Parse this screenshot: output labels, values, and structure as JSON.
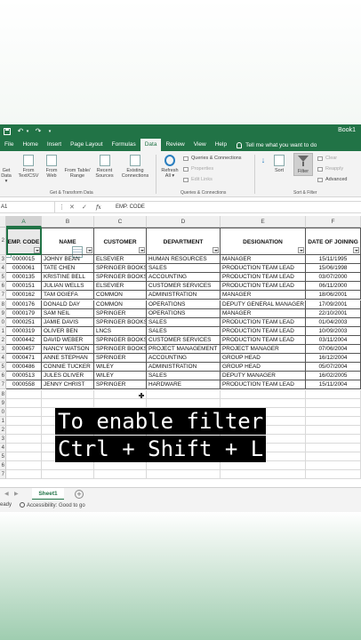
{
  "titlebar": {
    "book": "Book1"
  },
  "tabs": [
    "File",
    "Home",
    "Insert",
    "Page Layout",
    "Formulas",
    "Data",
    "Review",
    "View",
    "Help"
  ],
  "active_tab": "Data",
  "tell_me": "Tell me what you want to do",
  "ribbon": {
    "get_data": [
      "Get",
      "Data ▾"
    ],
    "from_text": [
      "From",
      "Text/CSV"
    ],
    "from_web": [
      "From",
      "Web"
    ],
    "from_table": [
      "From Table/",
      "Range"
    ],
    "recent_sources": [
      "Recent",
      "Sources"
    ],
    "existing_connections": [
      "Existing",
      "Connections"
    ],
    "group_get_transform": "Get & Transform Data",
    "refresh_all": [
      "Refresh",
      "All ▾"
    ],
    "queries_connections": "Queries & Connections",
    "properties": "Properties",
    "edit_links": "Edit Links",
    "group_queries": "Queries & Connections",
    "sort": "Sort",
    "filter": "Filter",
    "clear": "Clear",
    "reapply": "Reapply",
    "advanced": "Advanced",
    "group_sort_filter": "Sort & Filter"
  },
  "formula_bar": {
    "name_box": "A1",
    "fx": "fx",
    "content": "EMP. CODE"
  },
  "columns": [
    "A",
    "B",
    "C",
    "D",
    "E",
    "F"
  ],
  "headers": [
    "EMP. CODE",
    "NAME",
    "CUSTOMER",
    "DEPARTMENT",
    "DESIGNATION",
    "DATE OF JOINING"
  ],
  "rows": [
    [
      "0000015",
      "JOHNY BEAN",
      "ELSEVIER",
      "HUMAN RESOURCES",
      "MANAGER",
      "15/11/1995"
    ],
    [
      "0000061",
      "TATE CHEN",
      "SPRINGER BOOKS",
      "SALES",
      "PRODUCTION TEAM LEAD",
      "15/06/1998"
    ],
    [
      "0000135",
      "KRISTINE BELL",
      "SPRINGER BOOKS",
      "ACCOUNTING",
      "PRODUCTION TEAM LEAD",
      "03/07/2000"
    ],
    [
      "0000151",
      "JULIAN WELLS",
      "ELSEVIER",
      "CUSTOMER SERVICES",
      "PRODUCTION TEAM LEAD",
      "06/11/2000"
    ],
    [
      "0000162",
      "TAM OGIEFA",
      "COMMON",
      "ADMINISTRATION",
      "MANAGER",
      "18/06/2001"
    ],
    [
      "0000176",
      "DONALD DAY",
      "COMMON",
      "OPERATIONS",
      "DEPUTY GENERAL MANAGER",
      "17/09/2001"
    ],
    [
      "0000179",
      "SAM NEIL",
      "SPRINGER",
      "OPERATIONS",
      "MANAGER",
      "22/10/2001"
    ],
    [
      "0000251",
      "JAMIE DAVIS",
      "SPRINGER BOOKS",
      "SALES",
      "PRODUCTION TEAM LEAD",
      "01/04/2003"
    ],
    [
      "0000319",
      "OLIVER BEN",
      "LNCS",
      "SALES",
      "PRODUCTION TEAM LEAD",
      "10/09/2003"
    ],
    [
      "0000442",
      "DAVID WEBER",
      "SPRINGER BOOKS",
      "CUSTOMER SERVICES",
      "PRODUCTION TEAM LEAD",
      "03/11/2004"
    ],
    [
      "0000457",
      "NANCY WATSON",
      "SPRINGER BOOKS",
      "PROJECT MANAGEMENT",
      "PROJECT MANAGER",
      "07/06/2004"
    ],
    [
      "0000471",
      "ANNE STEPHAN",
      "SPRINGER",
      "ACCOUNTING",
      "GROUP HEAD",
      "16/12/2004"
    ],
    [
      "0000486",
      "CONNIE TUCKER",
      "WILEY",
      "ADMINISTRATION",
      "GROUP HEAD",
      "05/07/2004"
    ],
    [
      "0000513",
      "JULES OLIVER",
      "WILEY",
      "SALES",
      "DEPUTY MANAGER",
      "16/02/2005"
    ],
    [
      "0000558",
      "JENNY CHRIST",
      "SPRINGER",
      "HARDWARE",
      "PRODUCTION TEAM LEAD",
      "15/11/2004"
    ]
  ],
  "row_numbers": [
    "2",
    "3",
    "4",
    "5",
    "6",
    "7",
    "8",
    "9",
    "0",
    "1",
    "2",
    "3",
    "4",
    "5",
    "6",
    "7",
    "8",
    "9",
    "0",
    "1",
    "2",
    "3",
    "4",
    "5",
    "6",
    "7"
  ],
  "caption": [
    "To enable filter",
    "Ctrl + Shift + L"
  ],
  "sheet_tab": "Sheet1",
  "add_sheet": "+",
  "status": {
    "ready": "eady",
    "accessibility": "Accessibility: Good to go"
  }
}
